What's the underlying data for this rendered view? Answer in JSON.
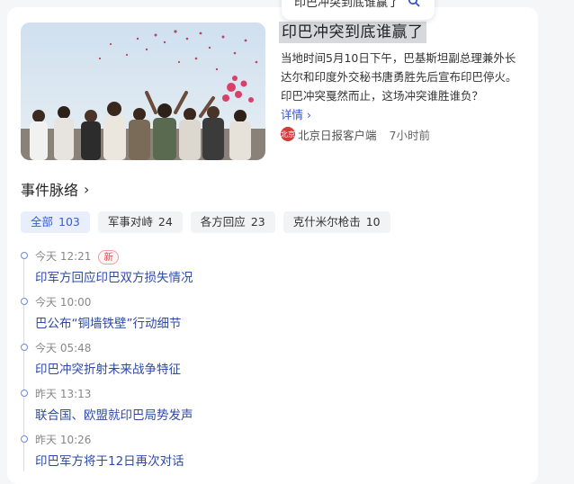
{
  "search": {
    "query": "印巴冲突到底谁赢了"
  },
  "article": {
    "headline": "印巴冲突到底谁赢了",
    "summary": "当地时间5月10日下午，巴基斯坦副总理兼外长达尔和印度外交秘书唐勇胜先后宣布印巴停火。印巴冲突戛然而止，这场冲突谁胜谁负？",
    "detail_link": "详情",
    "detail_chevron": "›",
    "source_logo": "北京",
    "source": "北京日报客户端",
    "time": "7小时前"
  },
  "section": {
    "title": "事件脉络",
    "chevron": "›"
  },
  "tabs": [
    {
      "label": "全部",
      "count": "103"
    },
    {
      "label": "军事对峙",
      "count": "24"
    },
    {
      "label": "各方回应",
      "count": "23"
    },
    {
      "label": "克什米尔枪击",
      "count": "10"
    }
  ],
  "timeline": [
    {
      "time": "今天 12:21",
      "badge": "新",
      "title": "印军方回应印巴双方损失情况"
    },
    {
      "time": "今天 10:00",
      "title": "巴公布“铜墙铁壁”行动细节"
    },
    {
      "time": "今天 05:48",
      "title": "印巴冲突折射未来战争特征"
    },
    {
      "time": "昨天 13:13",
      "title": "联合国、欧盟就印巴局势发声"
    },
    {
      "time": "昨天 10:26",
      "title": "印巴军方将于12日再次对话"
    }
  ],
  "colors": {
    "accent": "#3a5bd1",
    "link": "#2e4aa6",
    "badge": "#e0454d"
  }
}
